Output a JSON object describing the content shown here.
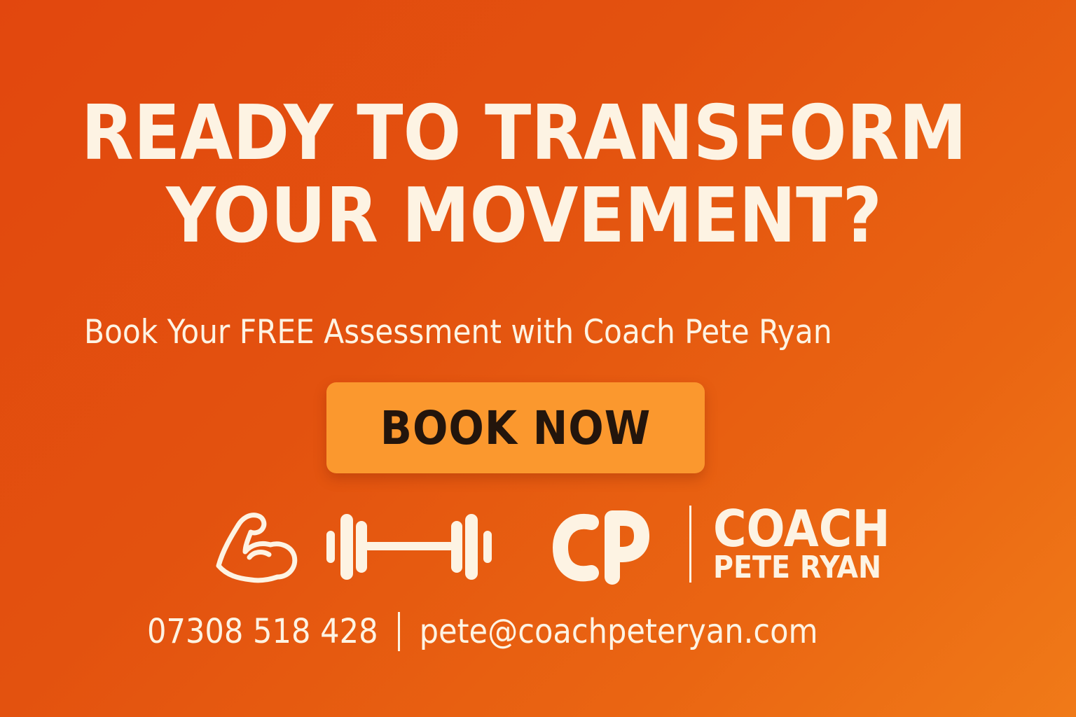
{
  "headline": {
    "line1": "READY TO TRANSFORM",
    "line2": "YOUR MOVEMENT?"
  },
  "subheadline": "Book Your FREE Assessment with Coach Pete Ryan",
  "cta": {
    "label": "BOOK NOW"
  },
  "icons": {
    "flexed_arm": "flexed-arm-icon",
    "barbell": "barbell-icon",
    "monogram": "cp-monogram-icon"
  },
  "brand": {
    "monogram": "CP",
    "title": "COACH",
    "name": "PETE RYAN"
  },
  "contact": {
    "phone": "07308 518 428",
    "email": "pete@coachpeteryan.com"
  },
  "colors": {
    "background_start": "#e2470e",
    "background_end": "#f07a18",
    "text": "#fdf3e3",
    "button": "#fb982e",
    "button_text": "#23150c"
  }
}
